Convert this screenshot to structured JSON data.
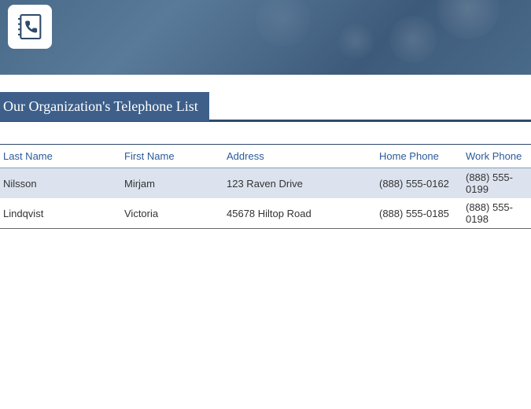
{
  "title": "Our Organization's Telephone List",
  "columns": {
    "lastName": "Last Name",
    "firstName": "First Name",
    "address": "Address",
    "homePhone": "Home Phone",
    "workPhone": "Work Phone"
  },
  "rows": [
    {
      "lastName": "Nilsson",
      "firstName": "Mirjam",
      "address": "123 Raven Drive",
      "homePhone": "(888) 555-0162",
      "workPhone": "(888) 555-0199"
    },
    {
      "lastName": "Lindqvist",
      "firstName": "Victoria",
      "address": "45678 Hiltop Road",
      "homePhone": "(888) 555-0185",
      "workPhone": "(888) 555-0198"
    }
  ]
}
